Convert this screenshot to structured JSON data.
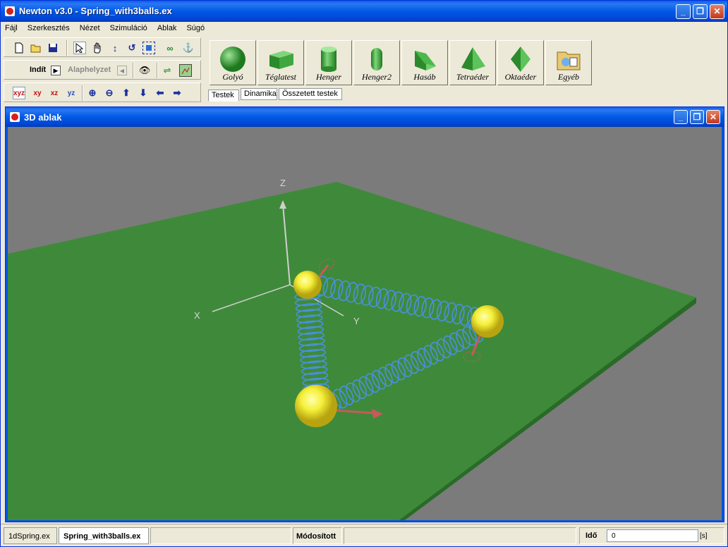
{
  "window": {
    "title": "Newton v3.0 - Spring_with3balls.ex",
    "minimize": "_",
    "maximize": "❐",
    "close": "✕"
  },
  "menu": [
    "Fájl",
    "Szerkesztés",
    "Nézet",
    "Szimuláció",
    "Ablak",
    "Súgó"
  ],
  "toolbar": {
    "start_label": "Indít",
    "reset_label": "Alaphelyzet"
  },
  "palette": [
    {
      "label": "Golyó",
      "icon": "sphere-icon"
    },
    {
      "label": "Téglatest",
      "icon": "box-icon"
    },
    {
      "label": "Henger",
      "icon": "cylinder-icon"
    },
    {
      "label": "Henger2",
      "icon": "capsule-icon"
    },
    {
      "label": "Hasáb",
      "icon": "prism-icon"
    },
    {
      "label": "Tetraéder",
      "icon": "tetrahedron-icon"
    },
    {
      "label": "Oktaéder",
      "icon": "octahedron-icon"
    },
    {
      "label": "Egyéb",
      "icon": "folder-icon"
    }
  ],
  "tabs": [
    "Testek",
    "Dinamika",
    "Összetett testek"
  ],
  "child_window": {
    "title": "3D ablak"
  },
  "scene": {
    "axes": {
      "x": "X",
      "y": "Y",
      "z": "Z"
    },
    "colors": {
      "floor": "#3f8a3a",
      "background": "#7b7b7b",
      "ball": "#f5f03a",
      "spring": "#4a90e2",
      "arrow": "#c85a5a"
    }
  },
  "statusbar": {
    "doc_tabs": [
      "1dSpring.ex",
      "Spring_with3balls.ex"
    ],
    "modified": "Módosított",
    "time_label": "Idő",
    "time_value": "0",
    "time_unit": "[s]"
  }
}
